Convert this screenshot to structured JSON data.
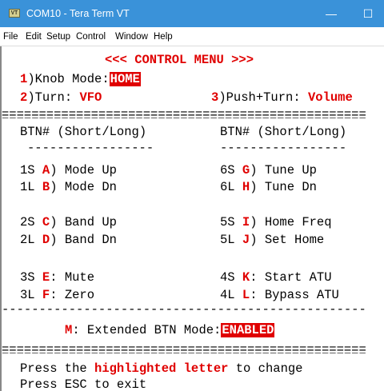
{
  "window": {
    "icon_label": "VT",
    "title": "COM10 - Tera Term VT",
    "minimize_glyph": "—",
    "maximize_glyph": "☐"
  },
  "menu": [
    "File",
    "Edit",
    "Setup",
    "Control",
    "Window",
    "Help"
  ],
  "terminal": {
    "header": "<<< CONTROL MENU >>>",
    "knob_num": "1",
    "knob_label": ")Knob Mode:",
    "knob_value": "HOME",
    "turn_num": "2",
    "turn_label": ")Turn:",
    "turn_value": "VFO",
    "push_num": "3",
    "push_label": ")Push+Turn:",
    "push_value": "Volume",
    "double_rule": "=================================================",
    "col1_header": "BTN# (Short/Long)",
    "col2_header": "BTN# (Short/Long)",
    "dash_rule": "-----------------",
    "rows": [
      {
        "b1": "1S ",
        "k1": "A",
        "t1": ") Mode Up",
        "b2": "6S ",
        "k2": "G",
        "t2": ") Tune Up"
      },
      {
        "b1": "1L ",
        "k1": "B",
        "t1": ") Mode Dn",
        "b2": "6L ",
        "k2": "H",
        "t2": ") Tune Dn"
      },
      {
        "b1": "2S ",
        "k1": "C",
        "t1": ") Band Up",
        "b2": "5S ",
        "k2": "I",
        "t2": ") Home Freq"
      },
      {
        "b1": "2L ",
        "k1": "D",
        "t1": ") Band Dn",
        "b2": "5L ",
        "k2": "J",
        "t2": ") Set Home"
      },
      {
        "b1": "3S ",
        "k1": "E",
        "t1": ": Mute",
        "b2": "4S ",
        "k2": "K",
        "t2": ": Start ATU"
      },
      {
        "b1": "3L ",
        "k1": "F",
        "t1": ": Zero",
        "b2": "4L ",
        "k2": "L",
        "t2": ": Bypass ATU"
      }
    ],
    "single_rule": "-------------------------------------------------",
    "ext_key": "M",
    "ext_label": ": Extended BTN Mode:",
    "ext_value": "ENABLED",
    "footer1_pre": "Press the ",
    "footer1_hl": "highlighted letter",
    "footer1_post": " to change",
    "footer2": "Press ESC to exit"
  },
  "colors": {
    "titlebar": "#3a92d9",
    "highlight": "#e00000"
  }
}
